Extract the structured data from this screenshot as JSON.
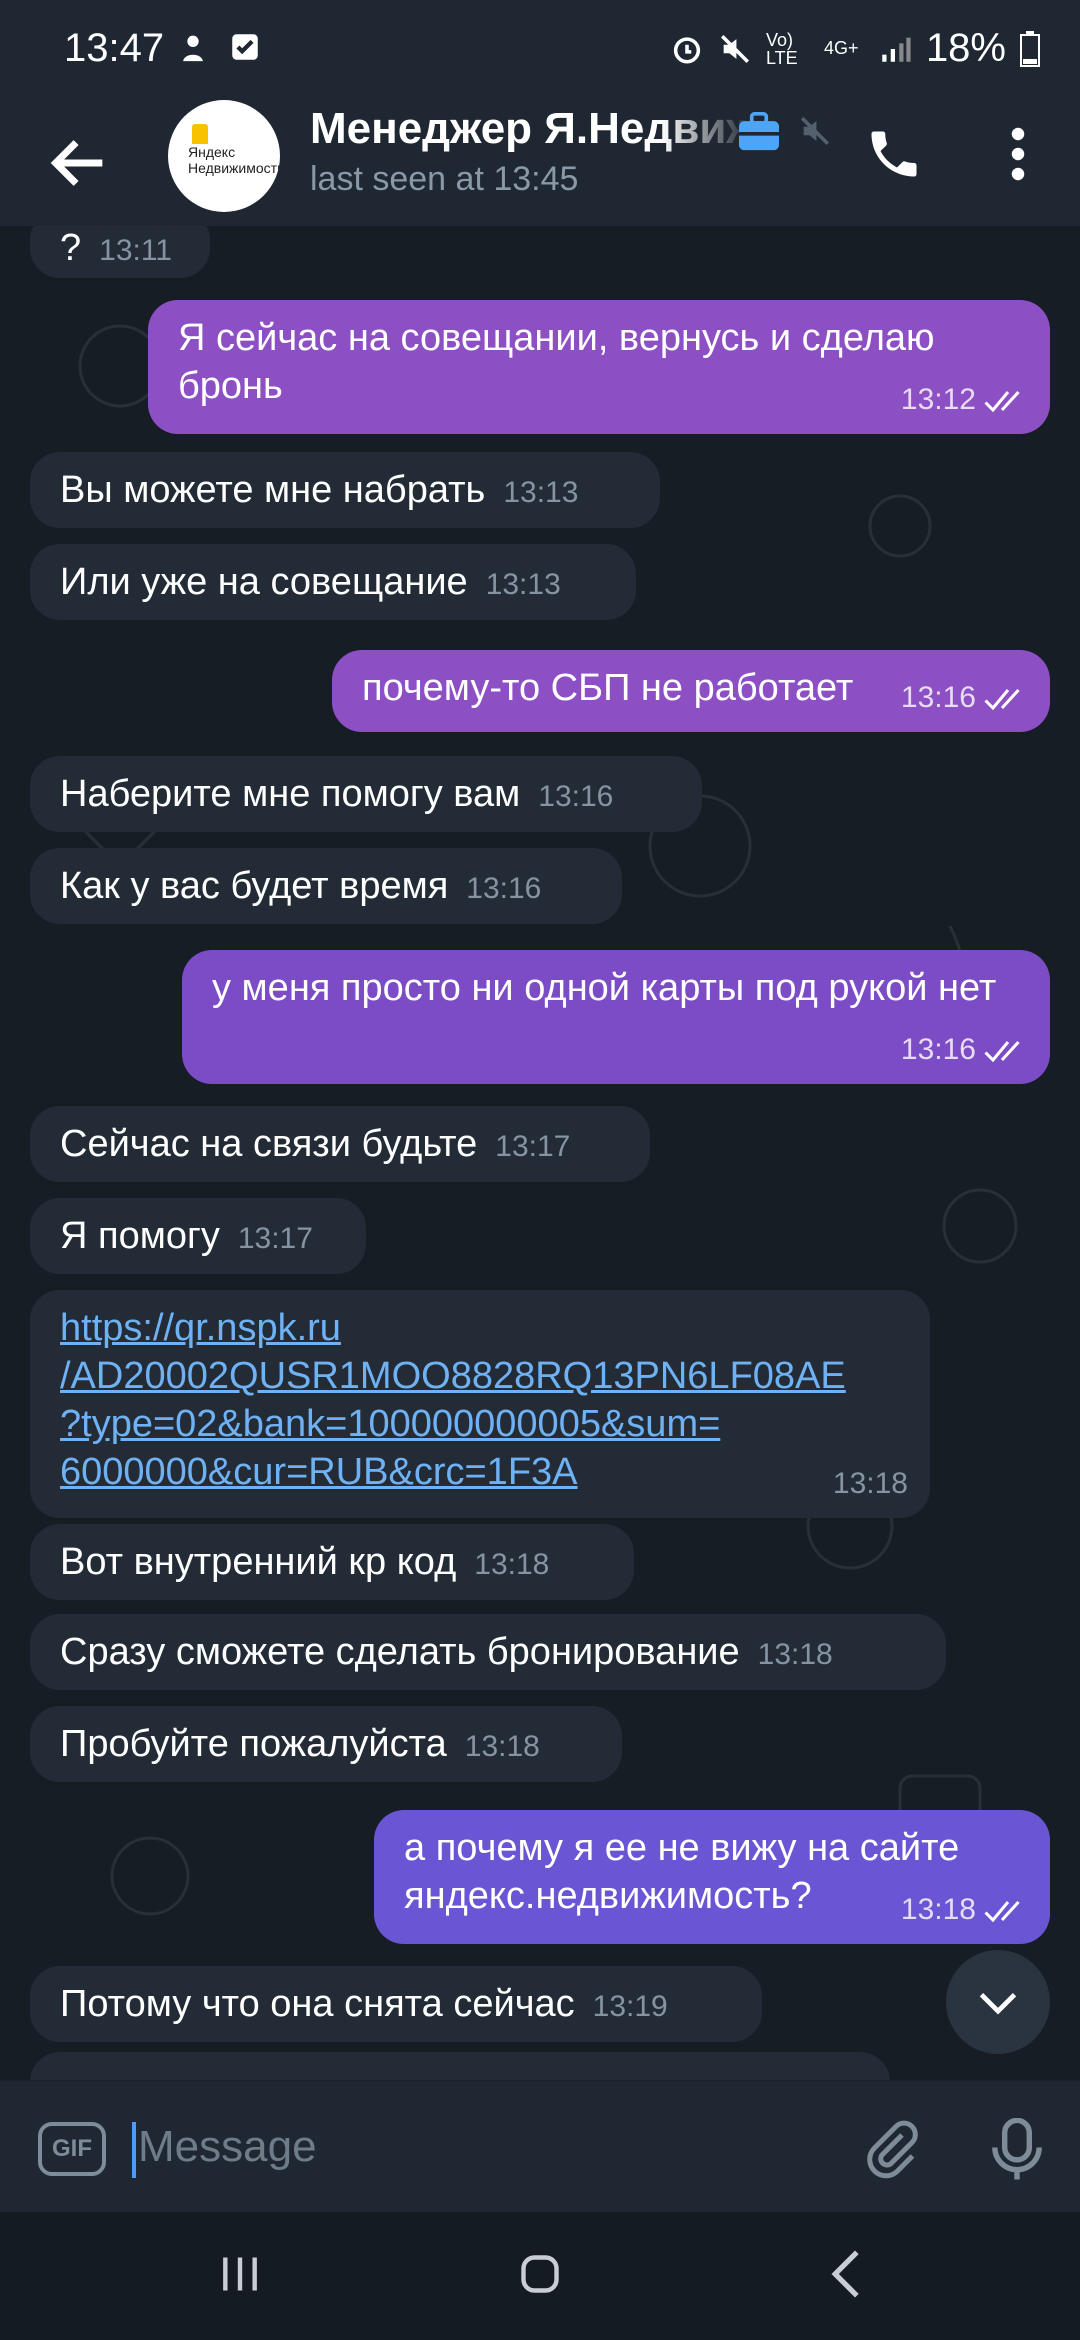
{
  "status_bar": {
    "time": "13:47",
    "battery": "18%",
    "network": "4G+",
    "volte": "Vo) LTE"
  },
  "header": {
    "title": "Менеджер Я.Недвижимость",
    "subtitle": "last seen at 13:45",
    "avatar_text": "Яндекс Недвижимость"
  },
  "messages": [
    {
      "dir": "in",
      "text": "?",
      "time": "13:11"
    },
    {
      "dir": "out",
      "text": "Я сейчас на совещании, вернусь и сделаю бронь",
      "time": "13:12"
    },
    {
      "dir": "in",
      "text": "Вы можете мне набрать",
      "time": "13:13"
    },
    {
      "dir": "in",
      "text": "Или уже на совещание",
      "time": "13:13"
    },
    {
      "dir": "out",
      "text": "почему-то СБП не работает",
      "time": "13:16"
    },
    {
      "dir": "in",
      "text": "Наберите мне помогу вам",
      "time": "13:16"
    },
    {
      "dir": "in",
      "text": "Как у вас будет время",
      "time": "13:16"
    },
    {
      "dir": "out",
      "text": "у меня просто ни одной карты под рукой нет",
      "time": "13:16"
    },
    {
      "dir": "in",
      "text": "Сейчас на связи будьте",
      "time": "13:17"
    },
    {
      "dir": "in",
      "text": "Я помогу",
      "time": "13:17"
    },
    {
      "dir": "in",
      "link_line1": "https://qr.nspk.ru",
      "link_line2": "/AD20002QUSR1MOO8828RQ13PN6LF08AE",
      "link_line3": "?type=02&bank=100000000005&sum=",
      "link_line4": "6000000&cur=RUB&crc=1F3A",
      "time": "13:18"
    },
    {
      "dir": "in",
      "text": "Вот внутренний кр код",
      "time": "13:18"
    },
    {
      "dir": "in",
      "text": "Сразу сможете сделать бронирование",
      "time": "13:18"
    },
    {
      "dir": "in",
      "text": "Пробуйте пожалуйста",
      "time": "13:18"
    },
    {
      "dir": "out",
      "text": "а почему я ее не вижу на сайте яндекс.недвижимость?",
      "time": "13:18"
    },
    {
      "dir": "in",
      "text": "Потому что она снята сейчас",
      "time": "13:19"
    }
  ],
  "input": {
    "placeholder": "Message",
    "gif_label": "GIF"
  },
  "colors": {
    "bubble_in": "#232c36",
    "bubble_out_1": "#8d4fc4",
    "bubble_out_2": "#7b4cc6",
    "bubble_out_3": "#6a55d4",
    "link": "#6fb1f5"
  },
  "icons": [
    "back-arrow-icon",
    "business-icon",
    "muted-icon",
    "phone-icon",
    "more-vert-icon",
    "gif-icon",
    "attach-icon",
    "mic-icon",
    "scroll-down-icon",
    "nav-recents-icon",
    "nav-home-icon",
    "nav-back-icon"
  ]
}
